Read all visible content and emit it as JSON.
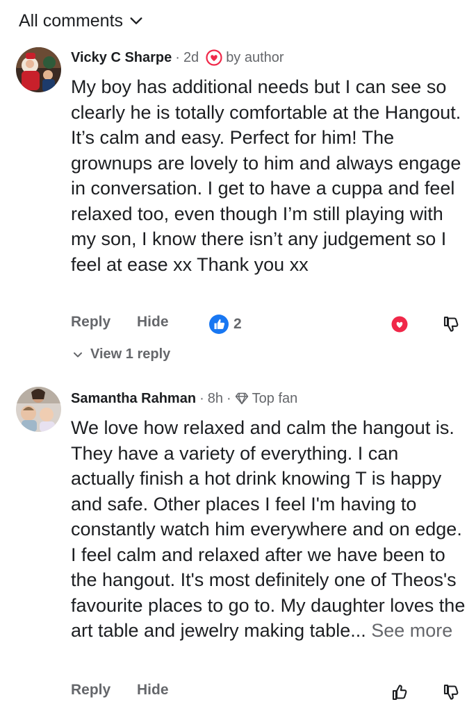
{
  "header": {
    "title": "All comments"
  },
  "comments": [
    {
      "author": "Vicky C Sharpe",
      "time": "2d",
      "badge": "by author",
      "body": "My boy has additional needs but I can see so clearly he is totally comfortable at the Hangout. It’s calm and easy. Perfect for him! The grownups are lovely to him and always engage in conversation. I get to have a cuppa and feel relaxed too, even though I’m still playing with my son, I know there isn’t any judgement so I feel at ease xx Thank you xx",
      "reply_label": "Reply",
      "hide_label": "Hide",
      "reaction_count": "2",
      "view_replies_label": "View 1 reply"
    },
    {
      "author": "Samantha Rahman",
      "time": "8h",
      "badge": "Top fan",
      "body": "We love how relaxed and calm the hangout is. They have a variety of everything. I can actually finish a hot drink knowing T is happy and safe. Other places I feel I'm having to constantly watch him everywhere and on edge. I feel calm and relaxed after we have been to the hangout. It's most definitely one of Theos's favourite places to go to. My daughter loves the art table and jewelry making table...",
      "see_more_label": "See more",
      "reply_label": "Reply",
      "hide_label": "Hide"
    }
  ],
  "colors": {
    "text_primary": "#1c1e21",
    "text_secondary": "#65676b",
    "like_blue": "#1877f2",
    "love_red": "#f02849"
  },
  "icons": [
    "chevron-down-icon",
    "heart-icon",
    "diamond-icon",
    "like-icon",
    "love-reaction-icon",
    "thumbs-down-icon",
    "thumbs-up-icon",
    "chevron-down-small-icon"
  ]
}
